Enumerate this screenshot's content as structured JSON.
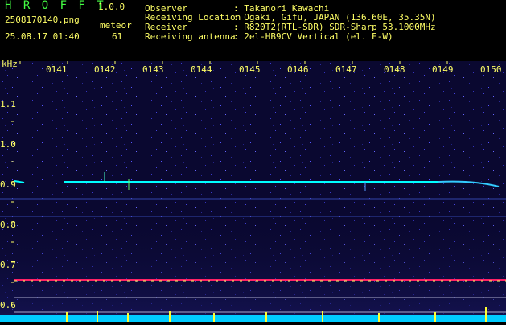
{
  "header": {
    "app_title": "H R O F F T",
    "version": "1.0.0",
    "filename": "2508170140.png",
    "datetime": "25.08.17 01:40",
    "meteor_label": "meteor",
    "meteor_count": "61",
    "info": [
      {
        "key": "Observer",
        "value": ": Takanori Kawachi"
      },
      {
        "key": "Receiving Location",
        "value": ": Ogaki, Gifu, JAPAN (136.60E, 35.35N)"
      },
      {
        "key": "Receiver",
        "value": ": R820T2(RTL-SDR) SDR-Sharp 53.1000MHz"
      },
      {
        "key": "Receiving antenna",
        "value": ": 2el-HB9CV Vertical (el. E-W)"
      }
    ]
  },
  "axes": {
    "y_unit": "kHz",
    "x_ticks": [
      "0141",
      "0142",
      "0143",
      "0144",
      "0145",
      "0146",
      "0147",
      "0148",
      "0149",
      "0150"
    ],
    "y_ticks": [
      "1.1",
      "1.0",
      "0.9",
      "0.8",
      "0.7",
      "0.6"
    ]
  },
  "colors": {
    "label": "#ffff66",
    "title": "#44ff44",
    "background": "#0a0830",
    "signal": "#00ffff",
    "carrier": "#ff2266"
  }
}
